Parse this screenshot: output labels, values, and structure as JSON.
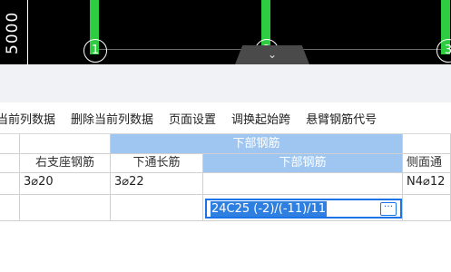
{
  "canvas": {
    "dimension_text": "5000",
    "axis_labels": [
      "1",
      "2",
      "3"
    ],
    "collapse_tab_icon": "chevron-down-icon",
    "colors": {
      "background": "#000000",
      "column": "#2ecc40"
    }
  },
  "toolbar": {
    "items": [
      "当前列数据",
      "删除当前列数据",
      "页面设置",
      "调换起始跨",
      "悬臂钢筋代号"
    ]
  },
  "table": {
    "group_header": "下部钢筋",
    "headers": {
      "right_support": "右支座钢筋",
      "bottom_through": "下通长筋",
      "bottom_rebar": "下部钢筋",
      "side": "侧面通"
    },
    "row1": {
      "right_support": "3⌀20",
      "bottom_through": "3⌀22",
      "bottom_rebar": "",
      "side": "N4⌀12"
    },
    "editor_value": "24C25 (-2)/(-11)/11",
    "editor_button": "···"
  }
}
